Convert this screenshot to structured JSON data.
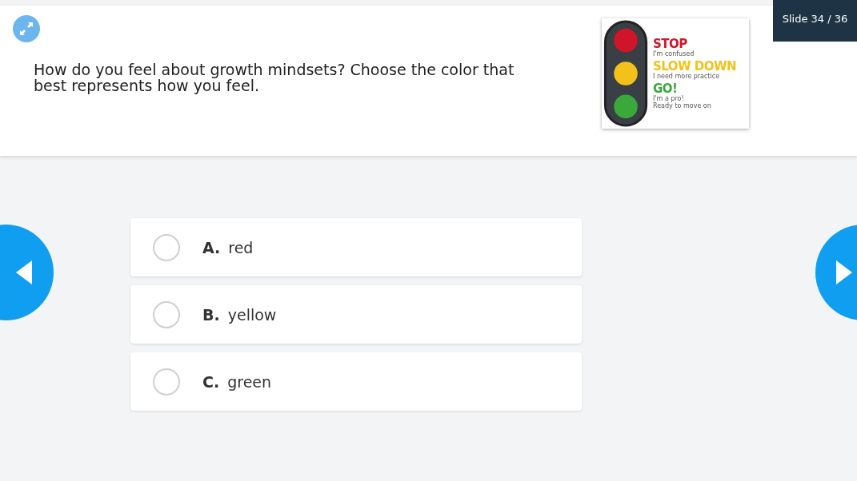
{
  "slide_counter": "Slide 34 / 36",
  "question": "How do you feel about growth mindsets? Choose the color that best represents how you feel.",
  "legend": [
    {
      "title": "STOP",
      "captions": [
        "I'm confused"
      ],
      "color": "#d0152a"
    },
    {
      "title": "SLOW DOWN",
      "captions": [
        "I need more practice"
      ],
      "color": "#f2c21b"
    },
    {
      "title": "GO!",
      "captions": [
        "I'm a pro!",
        "Ready to move on"
      ],
      "color": "#3aa83a"
    }
  ],
  "options": [
    {
      "letter": "A.",
      "text": "red",
      "selected": false
    },
    {
      "letter": "B.",
      "text": "yellow",
      "selected": false
    },
    {
      "letter": "C.",
      "text": "green",
      "selected": false
    }
  ]
}
